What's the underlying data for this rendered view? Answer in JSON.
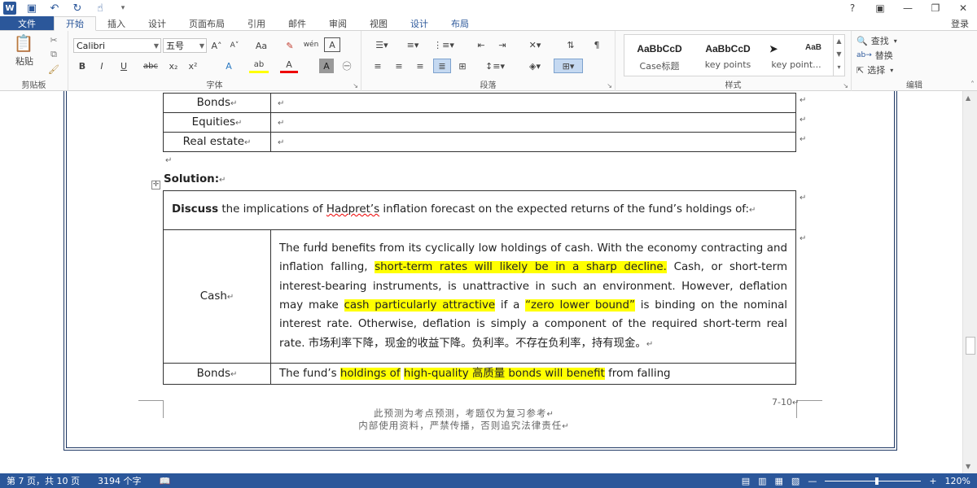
{
  "titlebar": {
    "app_icon": "W",
    "help": "?",
    "ribbon_opts": "▣",
    "minimize": "—",
    "restore": "❐",
    "close": "✕"
  },
  "tabs": {
    "file": "文件",
    "home": "开始",
    "insert": "插入",
    "design": "设计",
    "layout": "页面布局",
    "references": "引用",
    "mailings": "邮件",
    "review": "审阅",
    "view": "视图",
    "table_design": "设计",
    "table_layout": "布局",
    "login": "登录"
  },
  "ribbon": {
    "clipboard": {
      "paste": "粘贴",
      "label": "剪贴板"
    },
    "font": {
      "name": "Calibri",
      "size": "五号",
      "grow": "A˄",
      "shrink": "A˅",
      "case": "Aa",
      "clear": "✎",
      "phonetic": "wén",
      "border_char": "A",
      "bold": "B",
      "italic": "I",
      "underline": "U",
      "strike": "abc",
      "sub": "x₂",
      "sup": "x²",
      "effects": "A",
      "highlight": "ab",
      "color": "A",
      "shade": "A",
      "enclose": "㊀",
      "label": "字体"
    },
    "paragraph": {
      "label": "段落"
    },
    "styles": {
      "items": [
        {
          "sample": "AaBbCcD",
          "name": "Case标题"
        },
        {
          "sample": "AaBbCcD",
          "name": "key points"
        },
        {
          "sample": "➤",
          "name": "key point..."
        }
      ],
      "extra_sample": "AaB",
      "label": "样式"
    },
    "editing": {
      "find": "查找",
      "replace": "替换",
      "select": "选择",
      "label": "编辑"
    }
  },
  "doc": {
    "top_table": [
      {
        "label": "Bonds"
      },
      {
        "label": "Equities"
      },
      {
        "label": "Real estate"
      }
    ],
    "solution": "Solution:",
    "question_bold": "Discuss",
    "question_pre": " the implications of ",
    "question_name": "Hadpret’s",
    "question_post": " inflation forecast on the expected returns of the fund’s holdings of:",
    "cash_label": "Cash",
    "cash": {
      "p1": "The fund benefits from its cyclically low holdings of cash. With the economy contracting and inflation falling, ",
      "h1": "short-term rates will likely be in a sharp decline.",
      "p2": " Cash, or short-term interest-bearing instruments, is unattractive in such an environment. However, deflation may make ",
      "h2": "cash particularly attractive",
      "p3": " if a ",
      "h3": "“zero lower bound”",
      "p4": " is binding on the nominal interest rate. Otherwise, deflation is simply a component of the required short-term real rate. 市场利率下降，现金的收益下降。负利率。不存在负利率，持有现金。"
    },
    "bonds_label": "Bonds",
    "bonds": {
      "p1": "The fund’s ",
      "h1": "holdings of",
      "p2": " ",
      "h2": "high-quality 高质量 bonds will benefit",
      "p3": " from falling"
    },
    "page_number": "7-10",
    "footer1": "此预测为考点预测，考题仅为复习参考",
    "footer2": "内部使用资料，严禁传播，否则追究法律责任"
  },
  "status": {
    "page": "第 7 页，共 10 页",
    "words": "3194 个字",
    "zoom": "120%",
    "zoom_level_percent": 120
  },
  "colors": {
    "accent": "#2b579a",
    "highlight": "#ffff00",
    "frame": "#1f3864"
  }
}
